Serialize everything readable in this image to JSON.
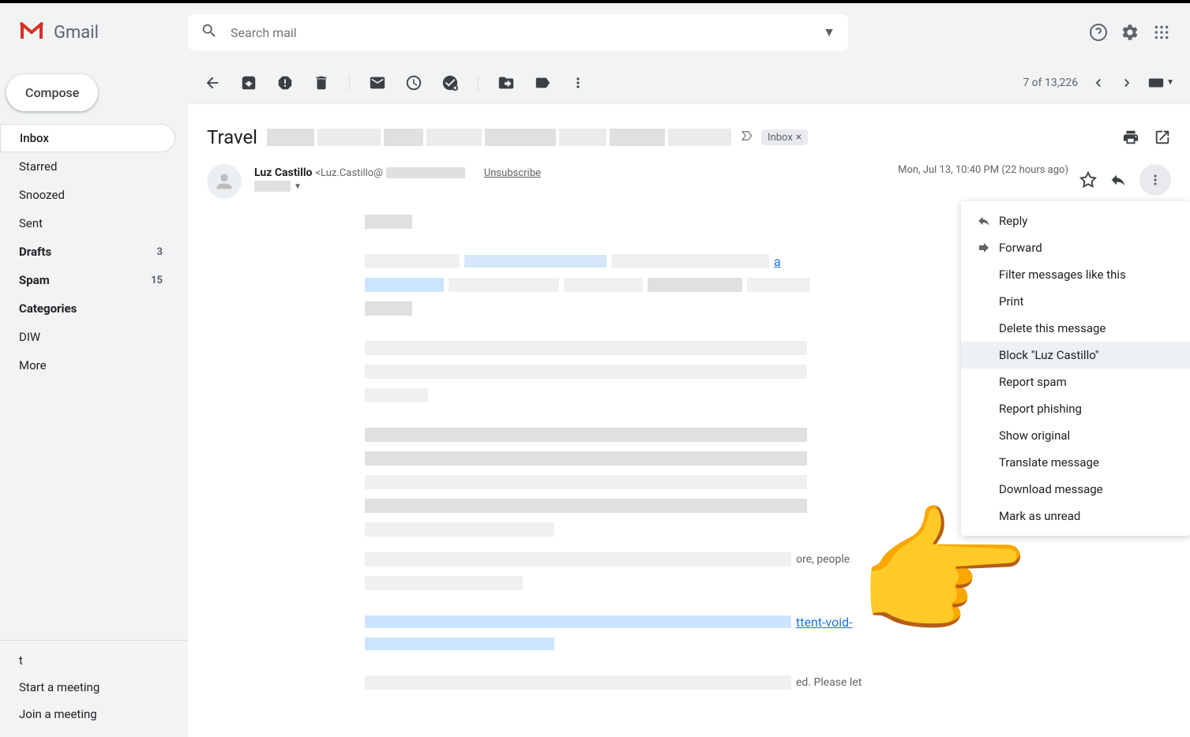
{
  "app": {
    "name": "Gmail",
    "search_placeholder": "Search mail"
  },
  "sidebar": {
    "compose": "Compose",
    "items": [
      {
        "label": "Inbox",
        "count": null,
        "active": true,
        "bold": false
      },
      {
        "label": "Starred",
        "count": null,
        "active": false,
        "bold": false
      },
      {
        "label": "Snoozed",
        "count": null,
        "active": false,
        "bold": false
      },
      {
        "label": "Sent",
        "count": null,
        "active": false,
        "bold": false
      },
      {
        "label": "Drafts",
        "count": "3",
        "active": false,
        "bold": true
      },
      {
        "label": "Spam",
        "count": "15",
        "active": false,
        "bold": true
      },
      {
        "label": "Categories",
        "count": null,
        "active": false,
        "bold": true
      },
      {
        "label": "DIW",
        "count": null,
        "active": false,
        "bold": false
      },
      {
        "label": "More",
        "count": null,
        "active": false,
        "bold": false
      }
    ],
    "meet_title": "t",
    "meet_start": "Start a meeting",
    "meet_join": "Join a meeting"
  },
  "toolbar": {
    "page_info": "7 of 13,226"
  },
  "email": {
    "subject": "Travel",
    "label": "Inbox",
    "sender_name": "Luz Castillo",
    "sender_email": "<Luz.Castillo@",
    "unsubscribe": "Unsubscribe",
    "date": "Mon, Jul 13, 10:40 PM (22 hours ago)",
    "body_fragment_1": "ore, people",
    "body_link_1": "ttent-void-",
    "body_fragment_2": "ed. Please let"
  },
  "menu": {
    "reply": "Reply",
    "forward": "Forward",
    "filter": "Filter messages like this",
    "print": "Print",
    "delete": "Delete this message",
    "block": "Block \"Luz Castillo\"",
    "report_spam": "Report spam",
    "report_phishing": "Report phishing",
    "show_original": "Show original",
    "translate": "Translate message",
    "download": "Download message",
    "mark_unread": "Mark as unread"
  }
}
